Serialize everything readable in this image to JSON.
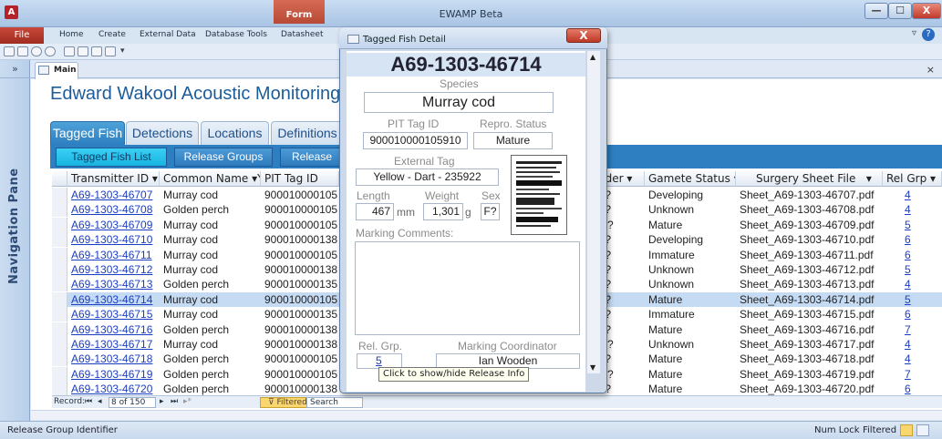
{
  "window": {
    "title": "EWAMP Beta",
    "app_icon": "A",
    "contextual_tab": "Form Tools",
    "minimize": "—",
    "maximize": "☐",
    "close": "X"
  },
  "ribbon": {
    "file": "File",
    "tabs": [
      "Home",
      "Create",
      "External Data",
      "Database Tools",
      "Datasheet"
    ],
    "help": "?",
    "minimize": "▿"
  },
  "nav_pane": {
    "label": "Navigation Pane",
    "toggle": "»"
  },
  "doc_tab": {
    "label": "Main",
    "close": "×"
  },
  "form": {
    "title": "Edward Wakool Acoustic Monitoring",
    "tabs": [
      "Tagged Fish",
      "Detections",
      "Locations",
      "Definitions"
    ],
    "subtabs": [
      "Tagged Fish List",
      "Release Groups",
      "Release"
    ]
  },
  "grid": {
    "headers": [
      "Transmitter ID",
      "Common Name",
      "PIT Tag ID",
      "nder",
      "Gamete Status",
      "Surgery Sheet File",
      "Rel Grp"
    ],
    "rows": [
      {
        "id": "A69-1303-46707",
        "name": "Murray cod",
        "pit": "900010000105",
        "gender": "F?",
        "gamete": "Developing",
        "file": "Sheet_A69-1303-46707.pdf",
        "grp": "4"
      },
      {
        "id": "A69-1303-46708",
        "name": "Golden perch",
        "pit": "900010000105",
        "gender": "F?",
        "gamete": "Unknown",
        "file": "Sheet_A69-1303-46708.pdf",
        "grp": "4"
      },
      {
        "id": "A69-1303-46709",
        "name": "Murray cod",
        "pit": "900010000105",
        "gender": "M?",
        "gamete": "Mature",
        "file": "Sheet_A69-1303-46709.pdf",
        "grp": "5"
      },
      {
        "id": "A69-1303-46710",
        "name": "Murray cod",
        "pit": "900010000138",
        "gender": "F?",
        "gamete": "Developing",
        "file": "Sheet_A69-1303-46710.pdf",
        "grp": "6"
      },
      {
        "id": "A69-1303-46711",
        "name": "Murray cod",
        "pit": "900010000105",
        "gender": "F?",
        "gamete": "Immature",
        "file": "Sheet_A69-1303-46711.pdf",
        "grp": "6"
      },
      {
        "id": "A69-1303-46712",
        "name": "Murray cod",
        "pit": "900010000138",
        "gender": "F?",
        "gamete": "Unknown",
        "file": "Sheet_A69-1303-46712.pdf",
        "grp": "5"
      },
      {
        "id": "A69-1303-46713",
        "name": "Golden perch",
        "pit": "900010000135",
        "gender": "F?",
        "gamete": "Unknown",
        "file": "Sheet_A69-1303-46713.pdf",
        "grp": "4"
      },
      {
        "id": "A69-1303-46714",
        "name": "Murray cod",
        "pit": "900010000105",
        "gender": "F?",
        "gamete": "Mature",
        "file": "Sheet_A69-1303-46714.pdf",
        "grp": "5"
      },
      {
        "id": "A69-1303-46715",
        "name": "Murray cod",
        "pit": "900010000135",
        "gender": "F?",
        "gamete": "Immature",
        "file": "Sheet_A69-1303-46715.pdf",
        "grp": "6"
      },
      {
        "id": "A69-1303-46716",
        "name": "Golden perch",
        "pit": "900010000138",
        "gender": "F?",
        "gamete": "Mature",
        "file": "Sheet_A69-1303-46716.pdf",
        "grp": "7"
      },
      {
        "id": "A69-1303-46717",
        "name": "Murray cod",
        "pit": "900010000138",
        "gender": "M?",
        "gamete": "Unknown",
        "file": "Sheet_A69-1303-46717.pdf",
        "grp": "4"
      },
      {
        "id": "A69-1303-46718",
        "name": "Golden perch",
        "pit": "900010000105",
        "gender": "F?",
        "gamete": "Mature",
        "file": "Sheet_A69-1303-46718.pdf",
        "grp": "4"
      },
      {
        "id": "A69-1303-46719",
        "name": "Golden perch",
        "pit": "900010000105",
        "gender": "M?",
        "gamete": "Mature",
        "file": "Sheet_A69-1303-46719.pdf",
        "grp": "7"
      },
      {
        "id": "A69-1303-46720",
        "name": "Golden perch",
        "pit": "900010000138",
        "gender": "F?",
        "gamete": "Mature",
        "file": "Sheet_A69-1303-46720.pdf",
        "grp": "6"
      }
    ],
    "selected_index": 7
  },
  "record_nav": {
    "label": "Record:",
    "position": "8 of 150",
    "filtered": "Filtered",
    "search": "Search"
  },
  "status_bar": {
    "left": "Release Group Identifier",
    "num_lock": "Num Lock",
    "filtered": "Filtered"
  },
  "dialog": {
    "title": "Tagged Fish Detail",
    "header": "A69-1303-46714",
    "species_label": "Species",
    "species": "Murray cod",
    "pit_label": "PIT Tag ID",
    "pit": "900010000105910",
    "repro_label": "Repro. Status",
    "repro": "Mature",
    "ext_label": "External Tag",
    "ext": "Yellow - Dart - 235922",
    "length_label": "Length",
    "length": "467",
    "length_unit": "mm",
    "weight_label": "Weight",
    "weight": "1,301",
    "weight_unit": "g",
    "sex_label": "Sex",
    "sex": "F?",
    "comments_label": "Marking Comments:",
    "relgrp_label": "Rel. Grp.",
    "relgrp": "5",
    "coord_label": "Marking Coordinator",
    "coord": "Ian Wooden",
    "tooltip": "Click to show/hide Release Info",
    "close": "X"
  }
}
